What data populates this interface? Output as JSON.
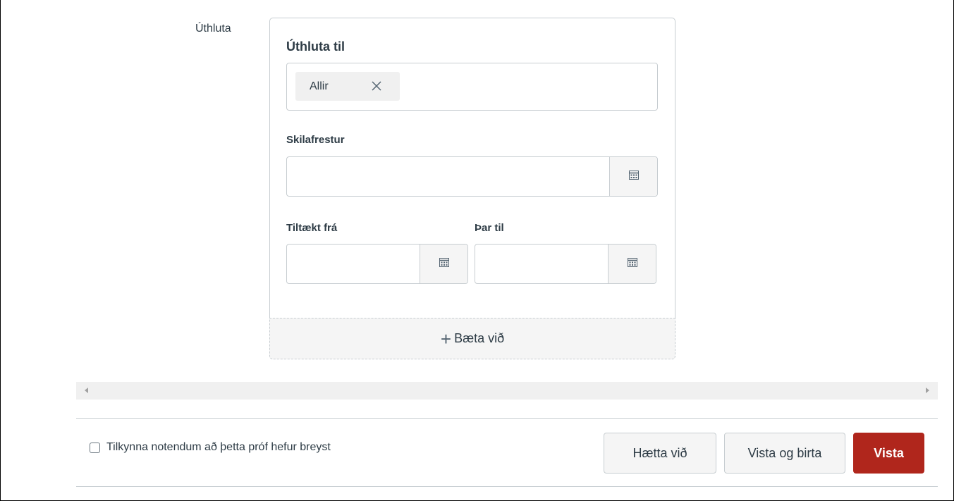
{
  "assign": {
    "section_label": "Úthluta",
    "card_heading": "Úthluta til",
    "assignees": [
      {
        "label": "Allir"
      }
    ],
    "due_label": "Skilafrestur",
    "due_value": "",
    "available_from_label": "Tiltækt frá",
    "available_from_value": "",
    "until_label": "Þar til",
    "until_value": "",
    "add_label": "Bæta við"
  },
  "footer": {
    "notify_label": "Tilkynna notendum að þetta próf hefur breyst",
    "notify_checked": false,
    "cancel_label": "Hætta við",
    "save_publish_label": "Vista og birta",
    "save_label": "Vista"
  },
  "colors": {
    "primary": "#b0261c",
    "border": "#c7cdd1",
    "text": "#2d3b45",
    "muted_bg": "#f5f5f5"
  },
  "icons": {
    "token_remove": "close-icon",
    "calendar": "calendar-icon",
    "add": "plus-icon"
  }
}
